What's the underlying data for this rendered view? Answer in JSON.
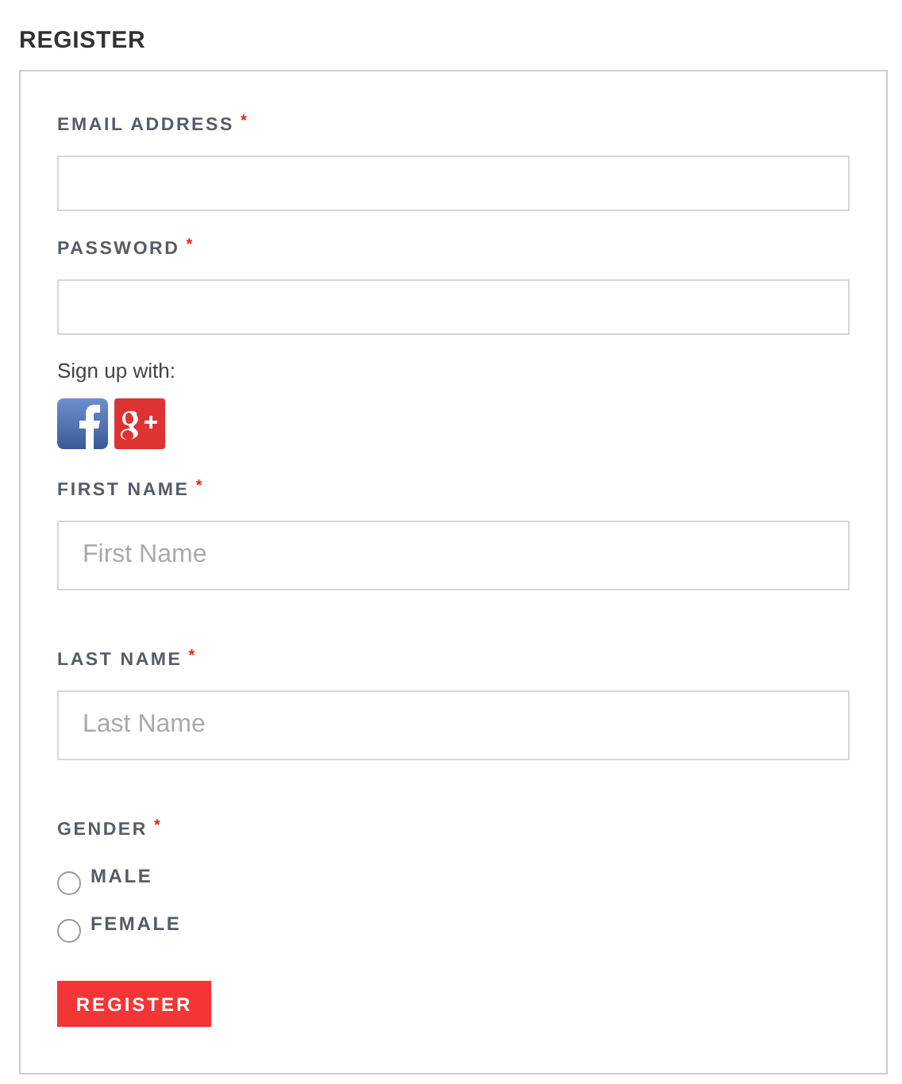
{
  "title": "REGISTER",
  "fields": [
    {
      "kind": "input",
      "label": "EMAIL ADDRESS",
      "required_mark": "*"
    },
    {
      "kind": "input",
      "label": "PASSWORD",
      "required_mark": "*"
    },
    {
      "kind": "social",
      "label": "Sign up with:"
    },
    {
      "kind": "input",
      "label": "FIRST NAME",
      "required_mark": "*",
      "placeholder": "First Name"
    },
    {
      "kind": "input",
      "label": "LAST NAME",
      "required_mark": "*",
      "placeholder": "Last Name"
    },
    {
      "kind": "radio",
      "label": "GENDER",
      "required_mark": "*",
      "options": [
        {
          "label": "MALE",
          "selected": false
        },
        {
          "label": "FEMALE",
          "selected": false
        }
      ]
    }
  ],
  "button": "REGISTER"
}
